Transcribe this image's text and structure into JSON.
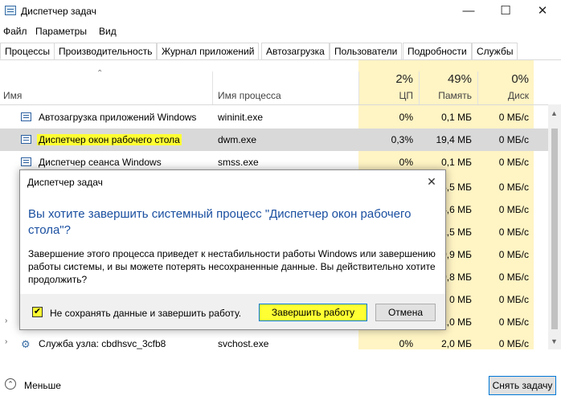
{
  "window": {
    "title": "Диспетчер задач",
    "minimize": "—",
    "maximize": "☐",
    "close": "✕"
  },
  "menu": [
    "Файл",
    "Параметры",
    "Вид"
  ],
  "tabs": [
    "Процессы",
    "Производительность",
    "Журнал приложений",
    "Автозагрузка",
    "Пользователи",
    "Подробности",
    "Службы"
  ],
  "columns": {
    "name": "Имя",
    "process": "Имя процесса",
    "cpu": {
      "pct": "2%",
      "label": "ЦП"
    },
    "memory": {
      "pct": "49%",
      "label": "Память"
    },
    "disk": {
      "pct": "0%",
      "label": "Диск"
    }
  },
  "rows": [
    {
      "name": "Автозагрузка приложений Windows",
      "process": "wininit.exe",
      "cpu": "0%",
      "memory": "0,1 МБ",
      "disk": "0 МБ/с"
    },
    {
      "name": "Диспетчер окон рабочего стола",
      "process": "dwm.exe",
      "cpu": "0,3%",
      "memory": "19,4 МБ",
      "disk": "0 МБ/с",
      "selected": true
    },
    {
      "name": "Диспетчер сеанса  Windows",
      "process": "smss.exe",
      "cpu": "0%",
      "memory": "0,1 МБ",
      "disk": "0 МБ/с"
    },
    {
      "name": "Служба узла: cbdhsvc_3cfb8",
      "process": "svchost.exe",
      "cpu": "0%",
      "memory": "2,0 МБ",
      "disk": "0 МБ/с"
    }
  ],
  "partial_memory": [
    "3,5 МБ",
    "4,6 МБ",
    "1,5 МБ",
    "9,9 МБ",
    "9,8 МБ",
    "0 МБ",
    "1,0 МБ"
  ],
  "partial_disk": [
    "0 МБ/с",
    "0 МБ/с",
    "0 МБ/с",
    "0 МБ/с",
    "0 МБ/с",
    "0 МБ/с",
    "0 МБ/с"
  ],
  "dialog": {
    "title": "Диспетчер задач",
    "heading": "Вы хотите завершить системный процесс \"Диспетчер окон рабочего стола\"?",
    "body": "Завершение этого процесса приведет к нестабильности работы Windows или завершению работы системы, и вы можете потерять несохраненные данные. Вы действительно хотите продолжить?",
    "checkbox_label": "Не сохранять данные и завершить работу.",
    "confirm_button": "Завершить работу",
    "cancel_button": "Отмена"
  },
  "footer": {
    "less": "Меньше",
    "end_task": "Снять задачу"
  },
  "colors": {
    "highlight": "#ffff33",
    "heading": "#1a4fa0",
    "accent": "#0078d7",
    "heat": "#fff4c4"
  }
}
